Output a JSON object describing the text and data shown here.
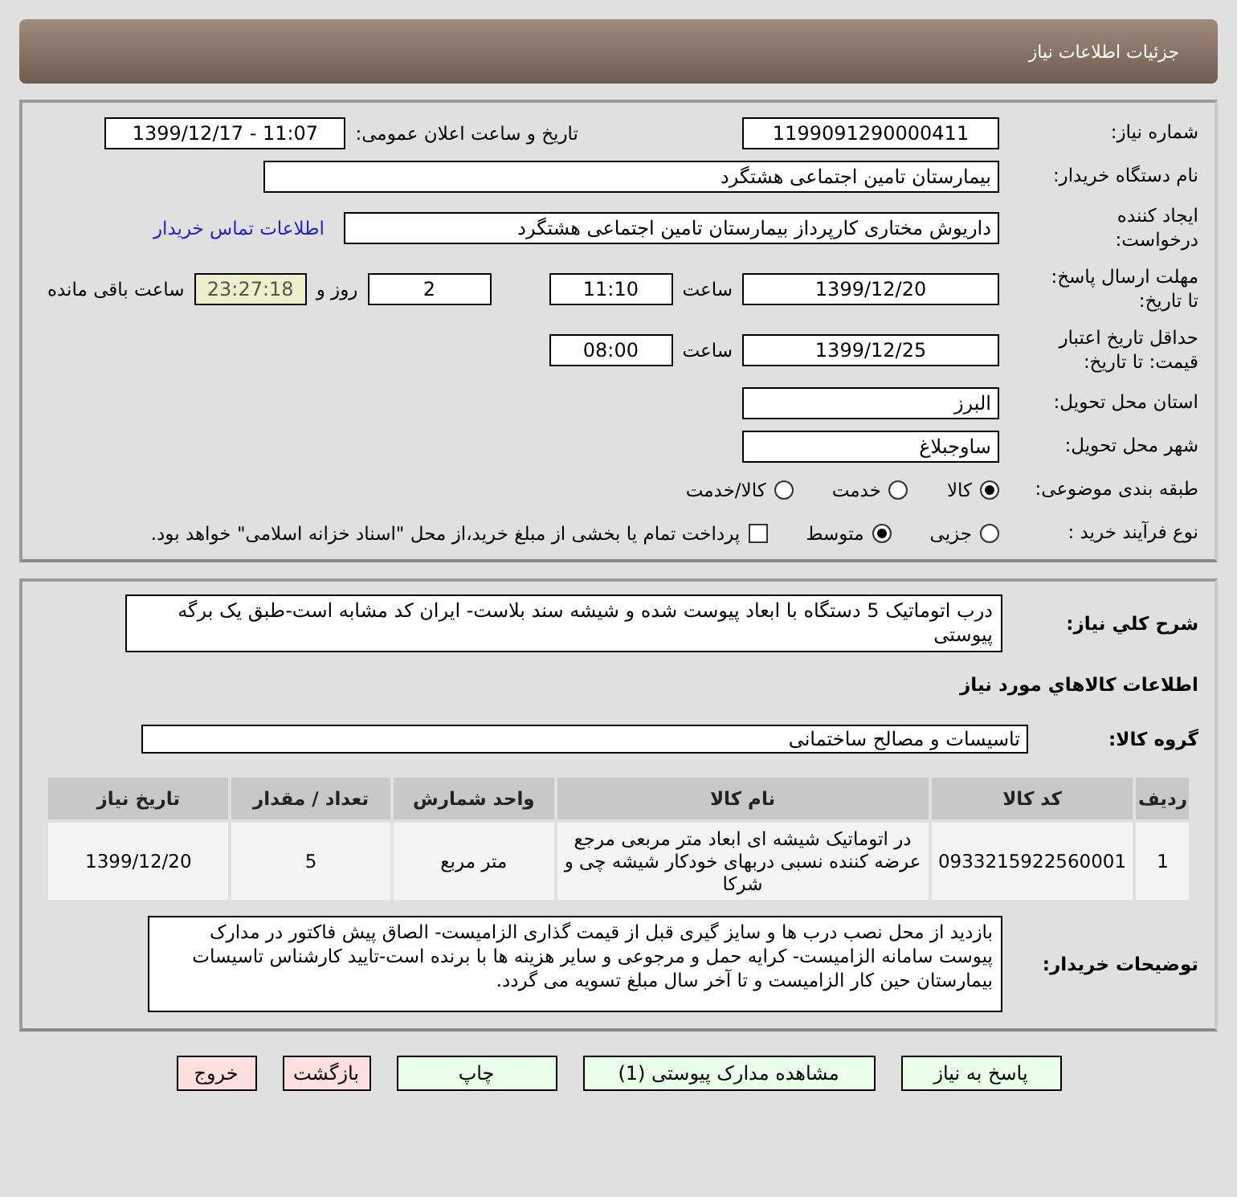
{
  "header": {
    "title": "جزئیات اطلاعات نیاز"
  },
  "need_number": {
    "label": "شماره نیاز:",
    "value": "1199091290000411"
  },
  "announce": {
    "label": "تاریخ و ساعت اعلان عمومی:",
    "value": "1399/12/17 - 11:07"
  },
  "buyer_org": {
    "label": "نام دستگاه خریدار:",
    "value": "بیمارستان تامین اجتماعی هشتگرد"
  },
  "requester": {
    "label_lines": [
      "ایجاد کننده",
      "درخواست:"
    ],
    "value": "داریوش مختاری کارپرداز بیمارستان تامین اجتماعی هشتگرد",
    "link": "اطلاعات تماس خریدار"
  },
  "reply_deadline": {
    "label_lines": [
      "مهلت ارسال پاسخ:",
      "تا تاریخ:"
    ],
    "date": "1399/12/20",
    "time_label": "ساعت",
    "time": "11:10",
    "days": "2",
    "days_label": "روز و",
    "remaining": "23:27:18",
    "remaining_label": "ساعت باقی مانده"
  },
  "price_validity": {
    "label_lines": [
      "حداقل تاریخ اعتبار",
      "قیمت: تا تاریخ:"
    ],
    "date": "1399/12/25",
    "time_label": "ساعت",
    "time": "08:00"
  },
  "province": {
    "label": "استان محل تحویل:",
    "value": "البرز"
  },
  "city": {
    "label": "شهر محل تحویل:",
    "value": "ساوجبلاغ"
  },
  "category": {
    "label": "طبقه بندی موضوعی:",
    "options": [
      {
        "label": "کالا",
        "selected": true
      },
      {
        "label": "خدمت",
        "selected": false
      },
      {
        "label": "کالا/خدمت",
        "selected": false
      }
    ]
  },
  "purchase_process": {
    "label": "نوع فرآیند خرید :",
    "options": [
      {
        "label": "جزیی",
        "selected": false
      },
      {
        "label": "متوسط",
        "selected": true
      }
    ],
    "payment": {
      "checked": false,
      "text": "پرداخت تمام یا بخشی از مبلغ خرید،از محل \"اسناد خزانه اسلامی\" خواهد بود."
    }
  },
  "summary": {
    "label": "شرح کلي نياز:",
    "value": "درب اتوماتیک 5 دستگاه با ابعاد پیوست شده و شیشه سند بلاست- ایران کد مشابه است-طبق یک برگه پیوستی"
  },
  "items_title": "اطلاعات کالاهاي مورد نياز",
  "goods_group": {
    "label": "گروه کالا:",
    "value": "تاسیسات و مصالح ساختمانی"
  },
  "table": {
    "columns": [
      "ردیف",
      "کد کالا",
      "نام کالا",
      "واحد شمارش",
      "تعداد / مقدار",
      "تاریخ نیاز"
    ],
    "rows": [
      [
        "1",
        "0933215922560001",
        "در اتوماتیک شیشه ای ابعاد متر مربعی مرجع عرضه کننده نسبی دربهای خودکار شیشه چی و شرکا",
        "متر مربع",
        "5",
        "1399/12/20"
      ]
    ]
  },
  "buyer_notes": {
    "label": "توضیحات خریدار:",
    "value": "بازدید از محل نصب درب ها و سایز گیری قبل از قیمت گذاری الزامیست- الصاق پیش فاکتور در مدارک پیوست سامانه الزامیست- کرایه حمل و مرجوعی و سایر هزینه ها با برنده است-تایید کارشناس تاسیسات بیمارستان حین کار الزامیست و تا آخر سال مبلغ تسویه می گردد."
  },
  "buttons": [
    {
      "label": "پاسخ به نیاز",
      "kind": "action"
    },
    {
      "label": "مشاهده مدارک پیوستی (1)",
      "kind": "action"
    },
    {
      "label": "چاپ",
      "kind": "action"
    },
    {
      "label": "بازگشت",
      "kind": "exit"
    },
    {
      "label": "خروج",
      "kind": "exit"
    }
  ]
}
